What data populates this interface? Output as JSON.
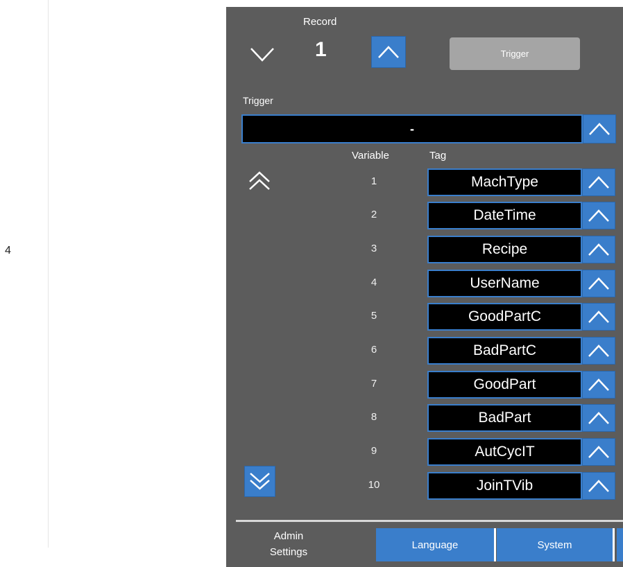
{
  "margin": {
    "page_number": "4"
  },
  "record": {
    "label": "Record",
    "value": "1",
    "trigger_button": "Trigger"
  },
  "trigger": {
    "label": "Trigger",
    "value": "-"
  },
  "columns": {
    "variable": "Variable",
    "tag": "Tag"
  },
  "rows": [
    {
      "num": "1",
      "tag": "MachType"
    },
    {
      "num": "2",
      "tag": "DateTime"
    },
    {
      "num": "3",
      "tag": "Recipe"
    },
    {
      "num": "4",
      "tag": "UserName"
    },
    {
      "num": "5",
      "tag": "GoodPartC"
    },
    {
      "num": "6",
      "tag": "BadPartC"
    },
    {
      "num": "7",
      "tag": "GoodPart"
    },
    {
      "num": "8",
      "tag": "BadPart"
    },
    {
      "num": "9",
      "tag": "AutCycIT"
    },
    {
      "num": "10",
      "tag": "JoinTVib"
    }
  ],
  "footer": {
    "admin_line1": "Admin",
    "admin_line2": "Settings",
    "tabs": [
      {
        "label": "Language"
      },
      {
        "label": "System"
      }
    ]
  },
  "icons": {
    "record_down": "chevron-down-icon",
    "record_up": "chevron-up-icon",
    "scroll_up": "double-chevron-up-icon",
    "scroll_down": "double-chevron-down-icon",
    "tag_select": "chevron-up-icon"
  },
  "colors": {
    "panel": "#5c5c5c",
    "accent": "#3a7ecb",
    "field": "#000000",
    "disabled_button": "#a5a5a5"
  }
}
